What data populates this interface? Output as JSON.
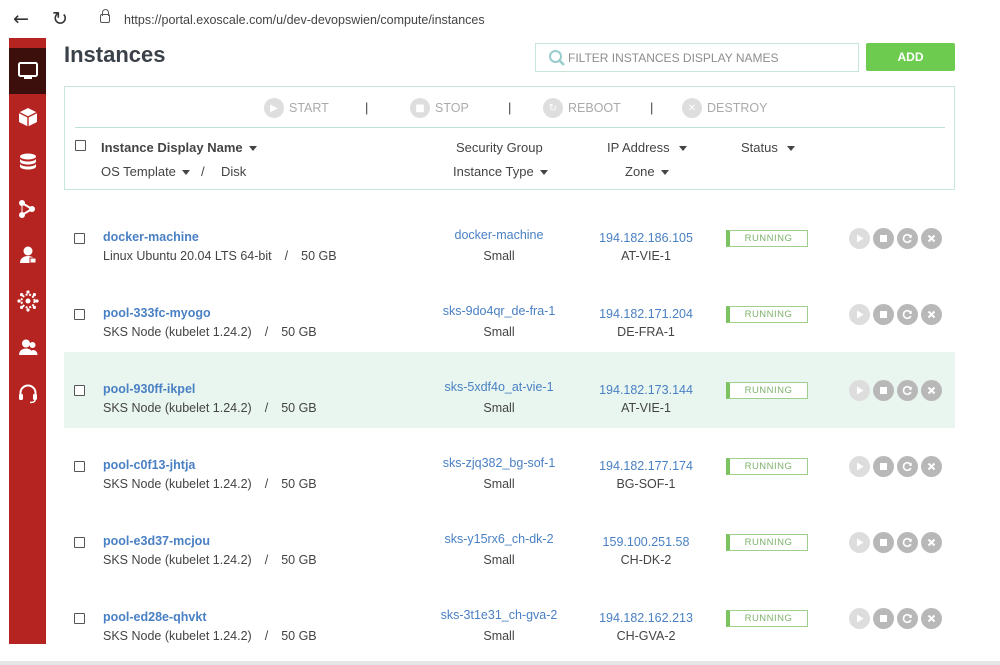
{
  "browser": {
    "back_icon": "arrow-left-icon",
    "reload_icon": "reload-icon",
    "lock_icon": "lock-icon",
    "url": "https://portal.exoscale.com/u/dev-devopswien/compute/instances"
  },
  "sidebar": {
    "color": "#b52420",
    "active_color": "#3c0f0d",
    "items": [
      {
        "icon": "monitor-icon",
        "active": true
      },
      {
        "icon": "cube-icon",
        "active": false
      },
      {
        "icon": "database-icon",
        "active": false
      },
      {
        "icon": "network-icon",
        "active": false
      },
      {
        "icon": "user-icon",
        "active": false
      },
      {
        "icon": "cluster-icon",
        "active": false
      },
      {
        "icon": "team-icon",
        "active": false
      },
      {
        "icon": "headset-icon",
        "active": false
      }
    ]
  },
  "page": {
    "title": "Instances",
    "filter_placeholder": "FILTER INSTANCES DISPLAY NAMES",
    "add_label": "ADD",
    "accent_color": "#6dcc50"
  },
  "actions": {
    "start": "START",
    "stop": "STOP",
    "reboot": "REBOOT",
    "destroy": "DESTROY",
    "separator": "|"
  },
  "columns": {
    "name": "Instance Display Name",
    "os_template": "OS Template",
    "disk_sep": "/",
    "disk": "Disk",
    "security_group": "Security Group",
    "instance_type": "Instance Type",
    "ip": "IP Address",
    "zone": "Zone",
    "status": "Status"
  },
  "instances": [
    {
      "name": "docker-machine",
      "os": "Linux Ubuntu 20.04 LTS 64-bit",
      "disk": "50 GB",
      "security_group": "docker-machine",
      "type": "Small",
      "ip": "194.182.186.105",
      "zone": "AT-VIE-1",
      "status": "RUNNING"
    },
    {
      "name": "pool-333fc-myogo",
      "os": "SKS Node (kubelet 1.24.2)",
      "disk": "50 GB",
      "security_group": "sks-9do4qr_de-fra-1",
      "type": "Small",
      "ip": "194.182.171.204",
      "zone": "DE-FRA-1",
      "status": "RUNNING"
    },
    {
      "name": "pool-930ff-ikpel",
      "os": "SKS Node (kubelet 1.24.2)",
      "disk": "50 GB",
      "security_group": "sks-5xdf4o_at-vie-1",
      "type": "Small",
      "ip": "194.182.173.144",
      "zone": "AT-VIE-1",
      "status": "RUNNING"
    },
    {
      "name": "pool-c0f13-jhtja",
      "os": "SKS Node (kubelet 1.24.2)",
      "disk": "50 GB",
      "security_group": "sks-zjq382_bg-sof-1",
      "type": "Small",
      "ip": "194.182.177.174",
      "zone": "BG-SOF-1",
      "status": "RUNNING"
    },
    {
      "name": "pool-e3d37-mcjou",
      "os": "SKS Node (kubelet 1.24.2)",
      "disk": "50 GB",
      "security_group": "sks-y15rx6_ch-dk-2",
      "type": "Small",
      "ip": "159.100.251.58",
      "zone": "CH-DK-2",
      "status": "RUNNING"
    },
    {
      "name": "pool-ed28e-qhvkt",
      "os": "SKS Node (kubelet 1.24.2)",
      "disk": "50 GB",
      "security_group": "sks-3t1e31_ch-gva-2",
      "type": "Small",
      "ip": "194.182.162.213",
      "zone": "CH-GVA-2",
      "status": "RUNNING"
    }
  ],
  "highlighted_row": 2,
  "row_controls": [
    "play-icon",
    "stop-icon",
    "reboot-icon",
    "destroy-icon"
  ]
}
